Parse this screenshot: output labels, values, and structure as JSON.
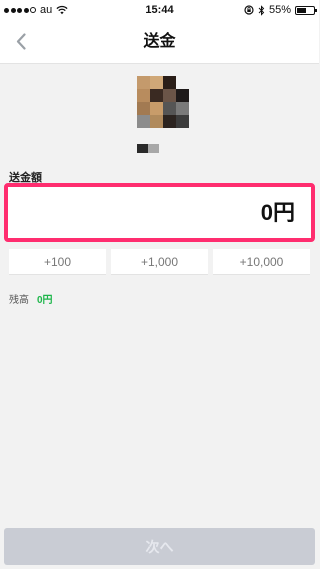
{
  "status_bar": {
    "carrier": "au",
    "time": "15:44",
    "battery": "55%",
    "battery_level": 0.55
  },
  "nav": {
    "title": "送金",
    "back_icon": "chevron-left-icon"
  },
  "form": {
    "amount_label": "送金額",
    "amount_value": "0円",
    "quick_add": [
      "+100",
      "+1,000",
      "+10,000"
    ],
    "balance_label": "残高",
    "balance_value": "0円"
  },
  "actions": {
    "next_label": "次へ"
  },
  "colors": {
    "highlight_border": "#ff2d6f",
    "balance_green": "#1db64a",
    "disabled_button": "#c9ccd4"
  }
}
